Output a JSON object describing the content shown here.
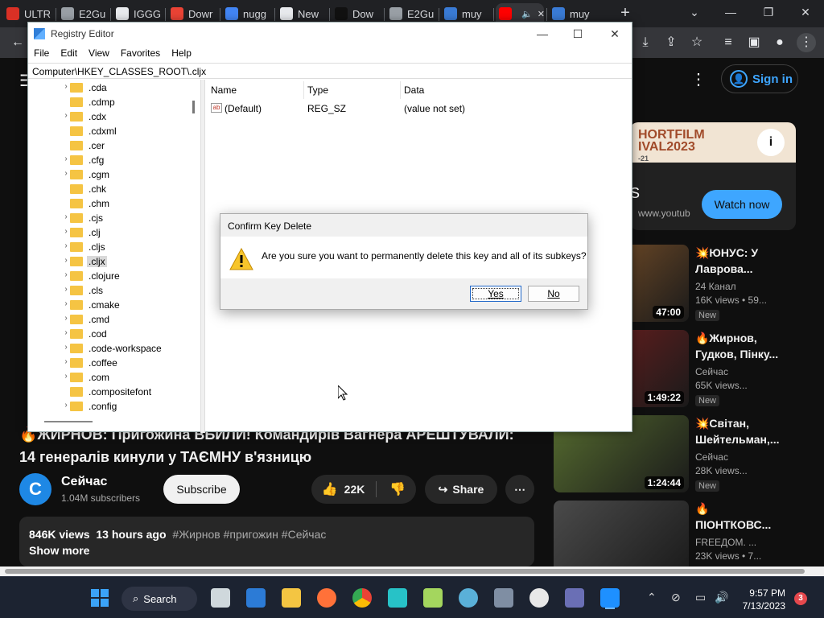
{
  "browser": {
    "tabs": [
      {
        "label": "ULTR",
        "color": "#d93025"
      },
      {
        "label": "E2Gu",
        "color": "#9aa0a6"
      },
      {
        "label": "IGGG",
        "color": "#e8eaed"
      },
      {
        "label": "Dowr",
        "color": "#ea4335"
      },
      {
        "label": "nugg",
        "color": "#4285f4"
      },
      {
        "label": "New",
        "color": "#e8eaed"
      },
      {
        "label": "Dow",
        "color": "#111111"
      },
      {
        "label": "E2Gu",
        "color": "#9aa0a6"
      },
      {
        "label": "muy",
        "color": "#3a7bd5"
      },
      {
        "label": "",
        "color": "#ff0000"
      },
      {
        "label": "muy",
        "color": "#3a7bd5"
      }
    ],
    "new_tab_icon": "plus-icon"
  },
  "youtube": {
    "sign_in": "Sign in",
    "ad": {
      "banner": "HORTFILM\nIVAL2023",
      "banner_sub": "-21",
      "letter": "S",
      "url": "www.youtub",
      "cta": "Watch now"
    },
    "related": [
      {
        "title": "💥ЮНУС: У Лаврова...",
        "channel": "24 Канал",
        "views": "16K views • 59...",
        "badge": "New",
        "duration": "47:00",
        "thumb_color": "#8b5a2b"
      },
      {
        "title": "🔥Жирнов, Гудков, Пінку...",
        "channel": "Сейчас",
        "views": "65K views...",
        "badge": "New",
        "duration": "1:49:22",
        "thumb_color": "#7a1f1f"
      },
      {
        "title": "💥Світан, Шейтельман,...",
        "channel": "Сейчас",
        "views": "28K views...",
        "badge": "New",
        "duration": "1:24:44",
        "thumb_color": "#556b2f"
      },
      {
        "title": "🔥 ПІОНТКОВС...",
        "channel": "FREEДОМ. ...",
        "views": "23K views • 7...",
        "badge": "",
        "duration": "",
        "thumb_color": "#4a4a4a"
      }
    ],
    "video_title": "🔥ЖИРНОВ: Пригожина ВБИЛИ! Командирів Вагнера АРЕШТУВАЛИ: 14 генералів кинули у ТАЄМНУ в'язницю",
    "channel_name": "Сейчас",
    "channel_initial": "С",
    "channel_subs": "1.04M subscribers",
    "subscribe": "Subscribe",
    "likes": "22K",
    "share": "Share",
    "desc_views": "846K views",
    "desc_time": "13 hours ago",
    "desc_tags": "#Жирнов #пригожин #Сейчас",
    "show_more": "Show more"
  },
  "regedit": {
    "title": "Registry Editor",
    "menu": [
      "File",
      "Edit",
      "View",
      "Favorites",
      "Help"
    ],
    "address": "Computer\\HKEY_CLASSES_ROOT\\.cljx",
    "tree": [
      {
        "label": ".cda",
        "chev": true
      },
      {
        "label": ".cdmp",
        "chev": false
      },
      {
        "label": ".cdx",
        "chev": true
      },
      {
        "label": ".cdxml",
        "chev": false
      },
      {
        "label": ".cer",
        "chev": false
      },
      {
        "label": ".cfg",
        "chev": true
      },
      {
        "label": ".cgm",
        "chev": true
      },
      {
        "label": ".chk",
        "chev": false
      },
      {
        "label": ".chm",
        "chev": false
      },
      {
        "label": ".cjs",
        "chev": true
      },
      {
        "label": ".clj",
        "chev": true
      },
      {
        "label": ".cljs",
        "chev": true
      },
      {
        "label": ".cljx",
        "chev": true,
        "selected": true
      },
      {
        "label": ".clojure",
        "chev": true
      },
      {
        "label": ".cls",
        "chev": true
      },
      {
        "label": ".cmake",
        "chev": true
      },
      {
        "label": ".cmd",
        "chev": true
      },
      {
        "label": ".cod",
        "chev": true
      },
      {
        "label": ".code-workspace",
        "chev": true
      },
      {
        "label": ".coffee",
        "chev": true
      },
      {
        "label": ".com",
        "chev": true
      },
      {
        "label": ".compositefont",
        "chev": false
      },
      {
        "label": ".config",
        "chev": true
      }
    ],
    "columns": {
      "name": "Name",
      "type": "Type",
      "data": "Data"
    },
    "rows": [
      {
        "name": "(Default)",
        "type": "REG_SZ",
        "data": "(value not set)"
      }
    ]
  },
  "dialog": {
    "title": "Confirm Key Delete",
    "message": "Are you sure you want to permanently delete this key and all of its subkeys?",
    "yes": "Yes",
    "no": "No"
  },
  "taskbar": {
    "search": "Search",
    "time": "9:57 PM",
    "date": "7/13/2023",
    "notifications": "3"
  }
}
